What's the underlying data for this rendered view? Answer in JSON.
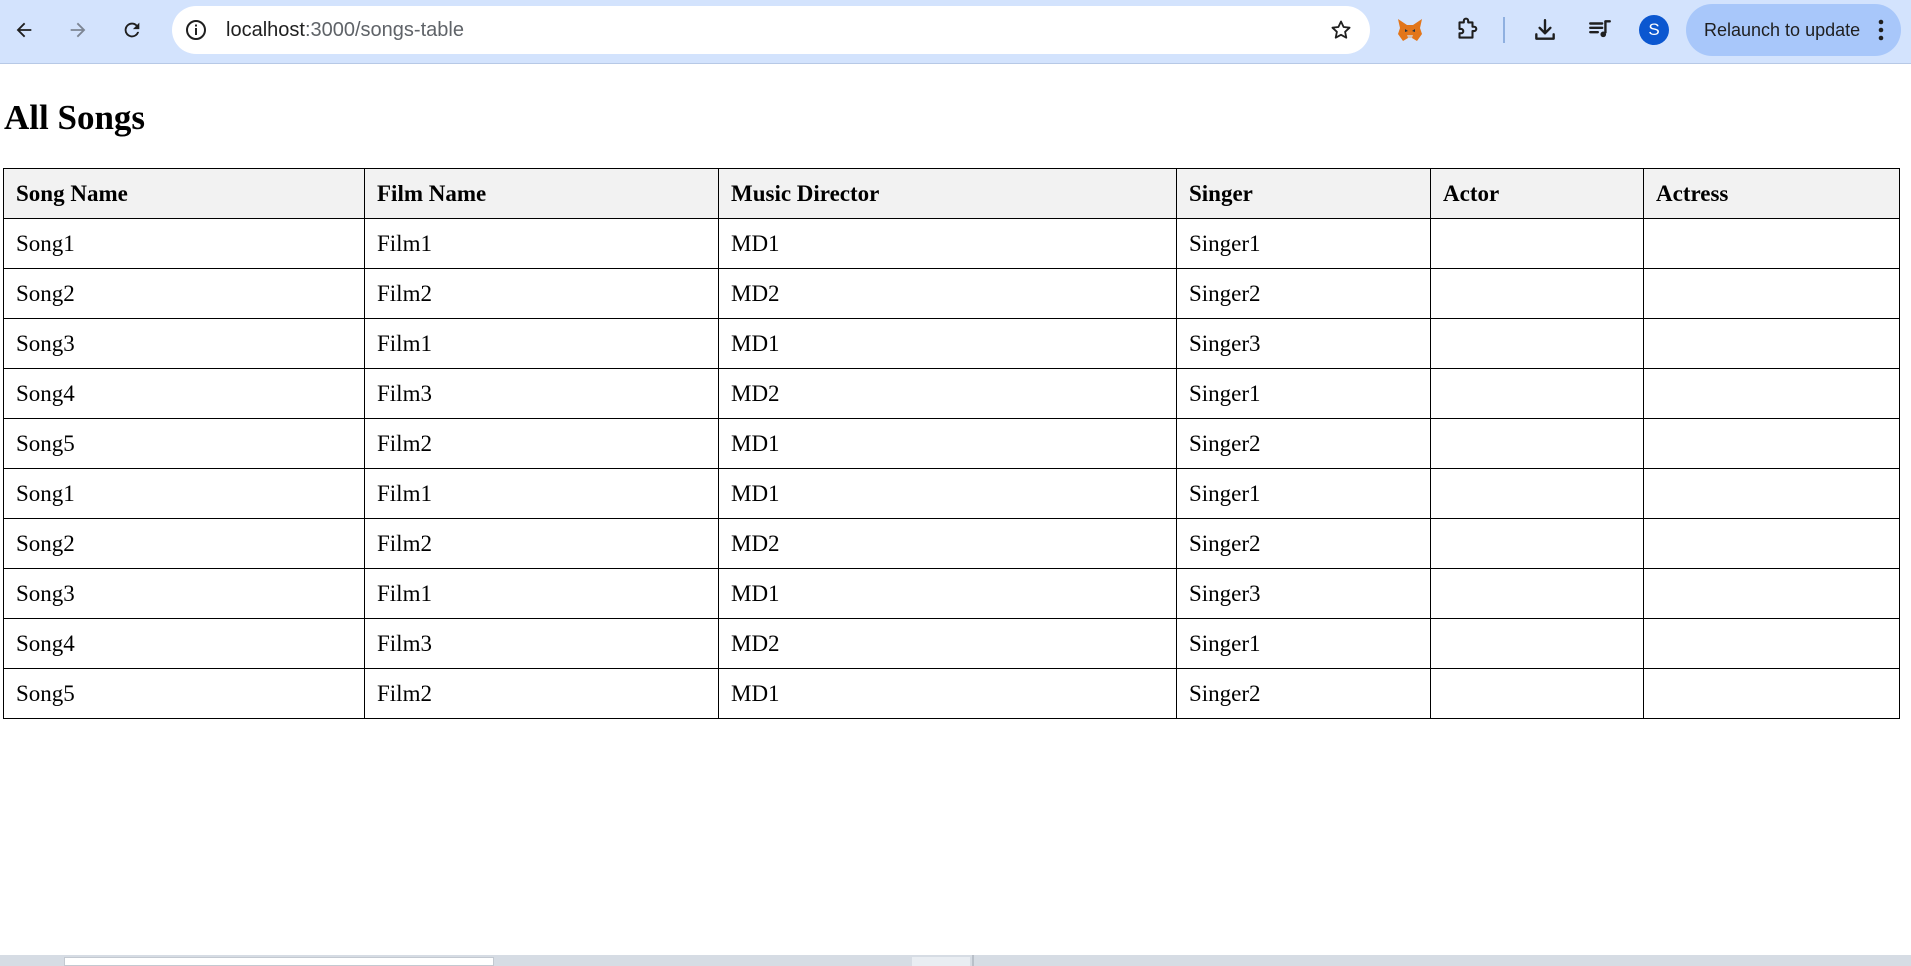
{
  "browser": {
    "url_host": "localhost",
    "url_path": ":3000/songs-table",
    "avatar_initial": "S",
    "relaunch_label": "Relaunch to update",
    "icons": {
      "back": "arrow-left-icon",
      "forward": "arrow-right-icon",
      "reload": "reload-icon",
      "site_info": "info-icon",
      "bookmark": "star-icon",
      "metamask": "fox-extension-icon",
      "extensions": "puzzle-icon",
      "downloads": "download-icon",
      "media": "playlist-icon",
      "menu": "kebab-menu-icon"
    },
    "colors": {
      "toolbar_bg": "#d3e3fd",
      "relaunch_bg": "#a8c7fa",
      "avatar_bg": "#0b57d0"
    }
  },
  "page": {
    "title": "All Songs"
  },
  "table": {
    "headers": [
      "Song Name",
      "Film Name",
      "Music Director",
      "Singer",
      "Actor",
      "Actress"
    ],
    "rows": [
      [
        "Song1",
        "Film1",
        "MD1",
        "Singer1",
        "",
        ""
      ],
      [
        "Song2",
        "Film2",
        "MD2",
        "Singer2",
        "",
        ""
      ],
      [
        "Song3",
        "Film1",
        "MD1",
        "Singer3",
        "",
        ""
      ],
      [
        "Song4",
        "Film3",
        "MD2",
        "Singer1",
        "",
        ""
      ],
      [
        "Song5",
        "Film2",
        "MD1",
        "Singer2",
        "",
        ""
      ],
      [
        "Song1",
        "Film1",
        "MD1",
        "Singer1",
        "",
        ""
      ],
      [
        "Song2",
        "Film2",
        "MD2",
        "Singer2",
        "",
        ""
      ],
      [
        "Song3",
        "Film1",
        "MD1",
        "Singer3",
        "",
        ""
      ],
      [
        "Song4",
        "Film3",
        "MD2",
        "Singer1",
        "",
        ""
      ],
      [
        "Song5",
        "Film2",
        "MD1",
        "Singer2",
        "",
        ""
      ]
    ]
  }
}
